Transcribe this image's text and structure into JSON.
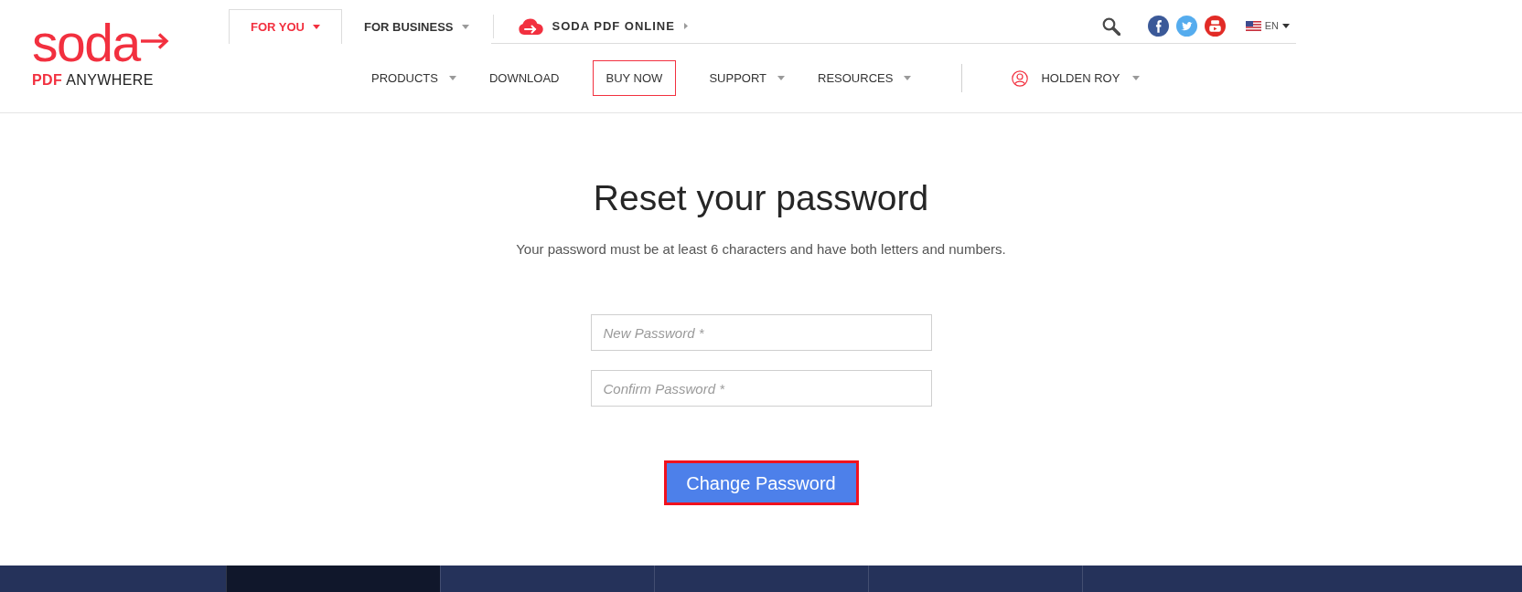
{
  "logo": {
    "wordmark": "soda",
    "tagline": "**PDF** ANYWHERE"
  },
  "audience_tabs": [
    {
      "label": "FOR YOU",
      "selected": true
    },
    {
      "label": "FOR BUSINESS",
      "selected": false
    }
  ],
  "online_link": {
    "label": "SODA PDF ONLINE"
  },
  "language": {
    "label": "EN"
  },
  "main_nav": [
    {
      "label": "PRODUCTS",
      "kind": "dropdown"
    },
    {
      "label": "DOWNLOAD",
      "kind": "link"
    },
    {
      "label": "BUY NOW",
      "kind": "button"
    },
    {
      "label": "SUPPORT",
      "kind": "dropdown"
    },
    {
      "label": "RESOURCES",
      "kind": "dropdown"
    }
  ],
  "user_menu": {
    "name": "HOLDEN ROY"
  },
  "form": {
    "title": "Reset your password",
    "hint": "Your password must be at least 6 characters and have both letters and numbers.",
    "fields": [
      {
        "placeholder": "New Password *"
      },
      {
        "placeholder": "Confirm Password *"
      }
    ],
    "submit": {
      "label": "Change Password",
      "focused": true
    }
  },
  "footer": {
    "columns": [
      {
        "selected": true
      },
      {
        "selected": false
      },
      {
        "selected": false
      },
      {
        "selected": false
      },
      {
        "selected": false
      }
    ]
  }
}
